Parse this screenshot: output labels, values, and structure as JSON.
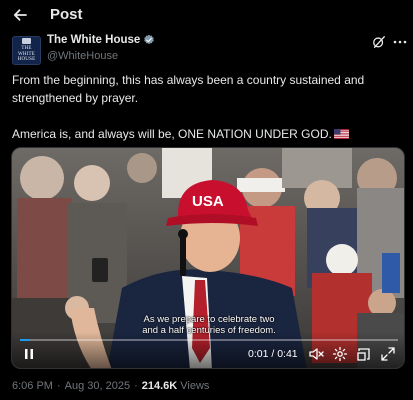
{
  "header": {
    "title": "Post",
    "back_icon": "arrow-left-icon"
  },
  "author": {
    "display_name": "The White House",
    "handle": "@WhiteHouse",
    "avatar_text": "THE WHITE HOUSE",
    "verified_badge": "verified-badge-icon",
    "badge_color": "#829aab"
  },
  "post": {
    "paragraph_1": "From the beginning, this has always been a country sustained and strengthened by prayer.",
    "paragraph_2": "America is, and always will be, ONE NATION UNDER GOD.",
    "emoji": "us-flag-icon"
  },
  "video": {
    "caption_line_1": "As we prepare to celebrate two",
    "caption_line_2": "and a half centuries of freedom.",
    "hat_text": "USA",
    "time": "0:01 / 0:41",
    "progress": 0.024,
    "controls": [
      "pause-icon",
      "volume-muted-icon",
      "settings-icon",
      "picture-in-picture-icon",
      "fullscreen-icon"
    ],
    "accent": "#1d9bf0"
  },
  "meta": {
    "time": "6:06 PM",
    "date": "Aug 30, 2025",
    "views_count": "214.6K",
    "views_label": "Views",
    "separator": "·"
  }
}
